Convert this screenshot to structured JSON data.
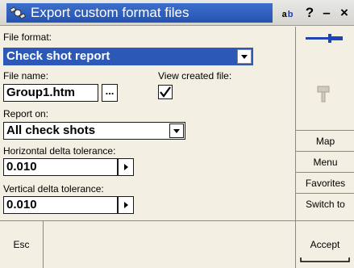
{
  "window": {
    "title": "Export custom format files",
    "kbd_a": "a",
    "kbd_b": "b",
    "help_label": "?",
    "minimize_label": "–",
    "close_label": "×"
  },
  "form": {
    "file_format": {
      "label": "File format:",
      "value": "Check shot report"
    },
    "file_name": {
      "label": "File name:",
      "value": "Group1.htm",
      "browse_label": "..."
    },
    "view_created_file": {
      "label": "View created file:",
      "checked": true
    },
    "report_on": {
      "label": "Report on:",
      "value": "All check shots"
    },
    "horizontal_tolerance": {
      "label": "Horizontal delta tolerance:",
      "value": "0.010"
    },
    "vertical_tolerance": {
      "label": "Vertical delta tolerance:",
      "value": "0.010"
    }
  },
  "right_panel": {
    "buttons": [
      "Map",
      "Menu",
      "Favorites",
      "Switch to"
    ]
  },
  "bottom": {
    "esc_label": "Esc",
    "accept_label": "Accept"
  },
  "colors": {
    "title_blue": "#2c59b8",
    "background": "#f3efe3"
  }
}
